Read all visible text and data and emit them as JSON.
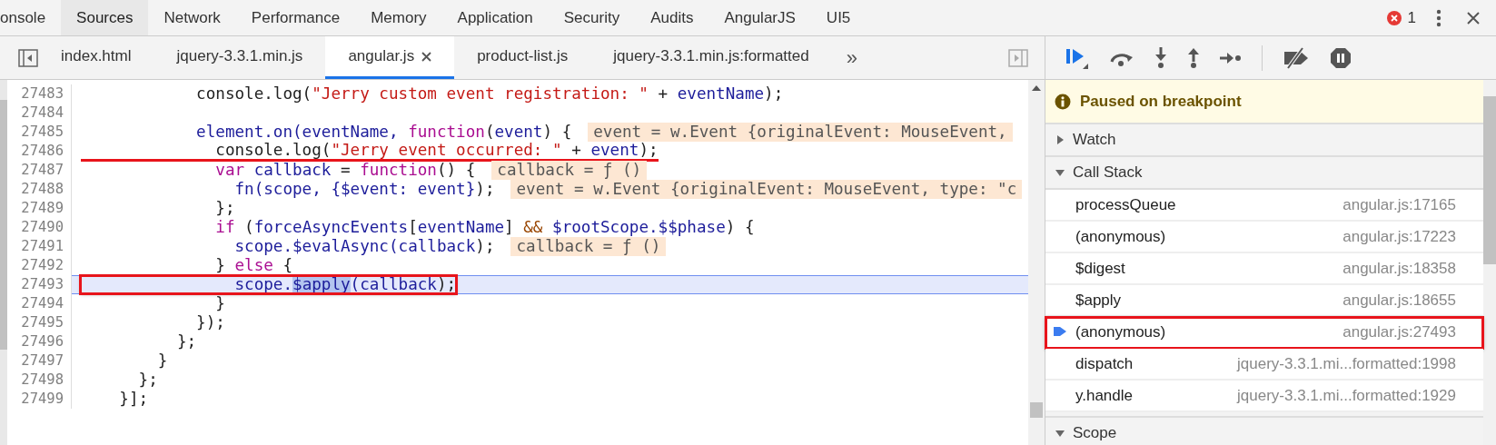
{
  "panel_tabs": [
    {
      "label": "onsole",
      "selected": false
    },
    {
      "label": "Sources",
      "selected": true
    },
    {
      "label": "Network",
      "selected": false
    },
    {
      "label": "Performance",
      "selected": false
    },
    {
      "label": "Memory",
      "selected": false
    },
    {
      "label": "Application",
      "selected": false
    },
    {
      "label": "Security",
      "selected": false
    },
    {
      "label": "Audits",
      "selected": false
    },
    {
      "label": "AngularJS",
      "selected": false
    },
    {
      "label": "UI5",
      "selected": false
    }
  ],
  "error_count": "1",
  "file_tabs": [
    {
      "label": "index.html",
      "selected": false
    },
    {
      "label": "jquery-3.3.1.min.js",
      "selected": false
    },
    {
      "label": "angular.js",
      "selected": true
    },
    {
      "label": "product-list.js",
      "selected": false
    },
    {
      "label": "jquery-3.3.1.min.js:formatted",
      "selected": false
    }
  ],
  "more_tabs": "»",
  "code": {
    "lines": [
      {
        "number": "27483",
        "current": false,
        "segments": [
          {
            "kind": "plain",
            "text": "            console.log("
          },
          {
            "kind": "string",
            "text": "\"Jerry custom event registration: \""
          },
          {
            "kind": "plain",
            "text": " + "
          },
          {
            "kind": "var",
            "text": "eventName"
          },
          {
            "kind": "plain",
            "text": ");"
          }
        ]
      },
      {
        "number": "27484",
        "current": false
      },
      {
        "number": "27485",
        "current": false,
        "segments": [
          {
            "kind": "var",
            "text": "            element.on(eventName, "
          },
          {
            "kind": "keyword",
            "text": "function"
          },
          {
            "kind": "plain",
            "text": "("
          },
          {
            "kind": "var",
            "text": "event"
          },
          {
            "kind": "plain",
            "text": ") {"
          }
        ],
        "inline_value": "event = w.Event {originalEvent: MouseEvent,"
      },
      {
        "number": "27486",
        "current": false,
        "underlined": true,
        "segments": [
          {
            "kind": "plain",
            "text": "              console.log("
          },
          {
            "kind": "string",
            "text": "\"Jerry event occurred: \""
          },
          {
            "kind": "plain",
            "text": " + "
          },
          {
            "kind": "var",
            "text": "event"
          },
          {
            "kind": "plain",
            "text": ");"
          }
        ]
      },
      {
        "number": "27487",
        "current": false,
        "segments": [
          {
            "kind": "keyword",
            "text": "              var"
          },
          {
            "kind": "var",
            "text": " callback"
          },
          {
            "kind": "plain",
            "text": " = "
          },
          {
            "kind": "keyword",
            "text": "function"
          },
          {
            "kind": "plain",
            "text": "() {"
          }
        ],
        "inline_value": "callback = ƒ ()"
      },
      {
        "number": "27488",
        "current": false,
        "segments": [
          {
            "kind": "var",
            "text": "                fn(scope, {$event: event}"
          },
          {
            "kind": "plain",
            "text": ");"
          }
        ],
        "inline_value": "event = w.Event {originalEvent: MouseEvent, type: \"c"
      },
      {
        "number": "27489",
        "current": false,
        "segments": [
          {
            "kind": "plain",
            "text": "              };"
          }
        ]
      },
      {
        "number": "27490",
        "current": false,
        "segments": [
          {
            "kind": "keyword",
            "text": "              if"
          },
          {
            "kind": "plain",
            "text": " ("
          },
          {
            "kind": "var",
            "text": "forceAsyncEvents"
          },
          {
            "kind": "plain",
            "text": "["
          },
          {
            "kind": "var",
            "text": "eventName"
          },
          {
            "kind": "plain",
            "text": "] "
          },
          {
            "kind": "operator",
            "text": "&&"
          },
          {
            "kind": "var",
            "text": " $rootScope.$$phase"
          },
          {
            "kind": "plain",
            "text": ") {"
          }
        ]
      },
      {
        "number": "27491",
        "current": false,
        "segments": [
          {
            "kind": "var",
            "text": "                scope.$evalAsync(callback"
          },
          {
            "kind": "plain",
            "text": ");"
          }
        ],
        "inline_value": "callback = ƒ ()"
      },
      {
        "number": "27492",
        "current": false,
        "segments": [
          {
            "kind": "plain",
            "text": "              } "
          },
          {
            "kind": "keyword",
            "text": "else"
          },
          {
            "kind": "plain",
            "text": " {"
          }
        ]
      },
      {
        "number": "27493",
        "current": true,
        "boxed": true,
        "segments": [
          {
            "kind": "var",
            "text": "                scope."
          },
          {
            "kind": "selection",
            "text": "$apply"
          },
          {
            "kind": "var",
            "text": "(callback"
          },
          {
            "kind": "plain",
            "text": ");"
          }
        ]
      },
      {
        "number": "27494",
        "current": false,
        "segments": [
          {
            "kind": "plain",
            "text": "              }"
          }
        ]
      },
      {
        "number": "27495",
        "current": false,
        "segments": [
          {
            "kind": "plain",
            "text": "            });"
          }
        ]
      },
      {
        "number": "27496",
        "current": false,
        "segments": [
          {
            "kind": "plain",
            "text": "          };"
          }
        ]
      },
      {
        "number": "27497",
        "current": false,
        "segments": [
          {
            "kind": "plain",
            "text": "        }"
          }
        ]
      },
      {
        "number": "27498",
        "current": false,
        "segments": [
          {
            "kind": "plain",
            "text": "      };"
          }
        ]
      },
      {
        "number": "27499",
        "current": false,
        "segments": [
          {
            "kind": "plain",
            "text": "    }];"
          }
        ]
      }
    ]
  },
  "paused_banner": "Paused on breakpoint",
  "watch": {
    "title": "Watch",
    "expanded": false
  },
  "call_stack": {
    "title": "Call Stack",
    "expanded": true,
    "frames": [
      {
        "name": "processQueue",
        "location": "angular.js:17165",
        "current": false,
        "annotated": false
      },
      {
        "name": "(anonymous)",
        "location": "angular.js:17223",
        "current": false,
        "annotated": false
      },
      {
        "name": "$digest",
        "location": "angular.js:18358",
        "current": false,
        "annotated": false
      },
      {
        "name": "$apply",
        "location": "angular.js:18655",
        "current": false,
        "annotated": false
      },
      {
        "name": "(anonymous)",
        "location": "angular.js:27493",
        "current": true,
        "annotated": true
      },
      {
        "name": "dispatch",
        "location": "jquery-3.3.1.mi...formatted:1998",
        "current": false,
        "annotated": false
      },
      {
        "name": "y.handle",
        "location": "jquery-3.3.1.mi...formatted:1929",
        "current": false,
        "annotated": false
      }
    ]
  },
  "scope": {
    "title": "Scope",
    "expanded": true
  }
}
